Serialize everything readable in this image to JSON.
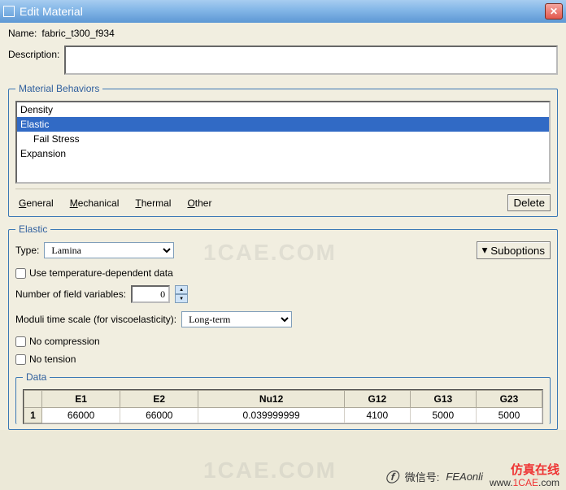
{
  "title": "Edit Material",
  "name_label": "Name:",
  "name_value": "fabric_t300_f934",
  "description_label": "Description:",
  "description_value": "",
  "behaviors_legend": "Material Behaviors",
  "behaviors": [
    {
      "label": "Density",
      "selected": false,
      "indent": false
    },
    {
      "label": "Elastic",
      "selected": true,
      "indent": false
    },
    {
      "label": "Fail Stress",
      "selected": false,
      "indent": true
    },
    {
      "label": "Expansion",
      "selected": false,
      "indent": false
    }
  ],
  "menus": {
    "general": "General",
    "mechanical": "Mechanical",
    "thermal": "Thermal",
    "other": "Other"
  },
  "delete_label": "Delete",
  "elastic": {
    "legend": "Elastic",
    "type_label": "Type:",
    "type_value": "Lamina",
    "suboptions_label": "Suboptions",
    "temp_dep_label": "Use temperature-dependent data",
    "temp_dep_checked": false,
    "num_vars_label": "Number of field variables:",
    "num_vars_value": "0",
    "moduli_label": "Moduli time scale (for viscoelasticity):",
    "moduli_value": "Long-term",
    "no_compression_label": "No compression",
    "no_compression_checked": false,
    "no_tension_label": "No tension",
    "no_tension_checked": false
  },
  "data": {
    "legend": "Data",
    "headers": [
      "E1",
      "E2",
      "Nu12",
      "G12",
      "G13",
      "G23"
    ],
    "rows": [
      {
        "num": "1",
        "cells": [
          "66000",
          "66000",
          "0.039999999",
          "4100",
          "5000",
          "5000"
        ]
      }
    ]
  },
  "watermark": "1CAE.COM",
  "overlay": {
    "wx": "微信号:",
    "fea": "FEAonli",
    "fz": "仿真在线",
    "url": "www.1CAE.com"
  }
}
